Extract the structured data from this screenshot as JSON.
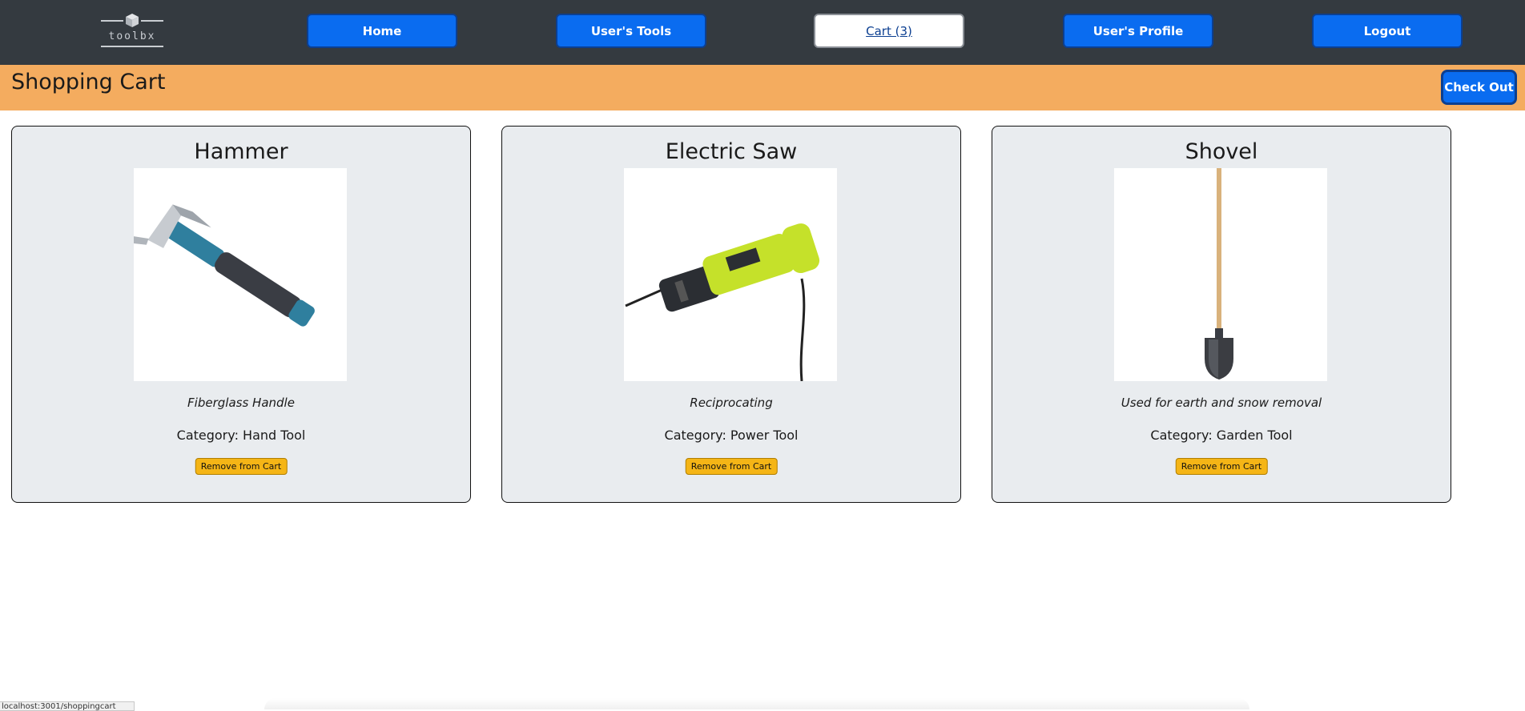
{
  "brand": {
    "logo_text": "toolbx"
  },
  "nav": {
    "home": "Home",
    "tools": "User's Tools",
    "cart": "Cart (3)",
    "profile": "User's Profile",
    "logout": "Logout"
  },
  "header": {
    "title": "Shopping Cart",
    "checkout": "Check Out"
  },
  "items": [
    {
      "name": "Hammer",
      "image_icon": "hammer-image",
      "description": "Fiberglass Handle",
      "category": "Category:  Hand Tool",
      "remove": "Remove from Cart"
    },
    {
      "name": "Electric Saw",
      "image_icon": "reciprocating-saw-image",
      "description": "Reciprocating",
      "category": "Category:  Power Tool",
      "remove": "Remove from Cart"
    },
    {
      "name": "Shovel",
      "image_icon": "shovel-image",
      "description": "Used for earth and snow removal",
      "category": "Category:  Garden Tool",
      "remove": "Remove from Cart"
    }
  ],
  "status_bar": {
    "url": "localhost:3001/shoppingcart"
  },
  "colors": {
    "navbar": "#343a40",
    "nav_button": "#0a6cf0",
    "header_bar": "#f4ac5f",
    "card_bg": "#e9ecef",
    "remove_button": "#f5b516"
  }
}
